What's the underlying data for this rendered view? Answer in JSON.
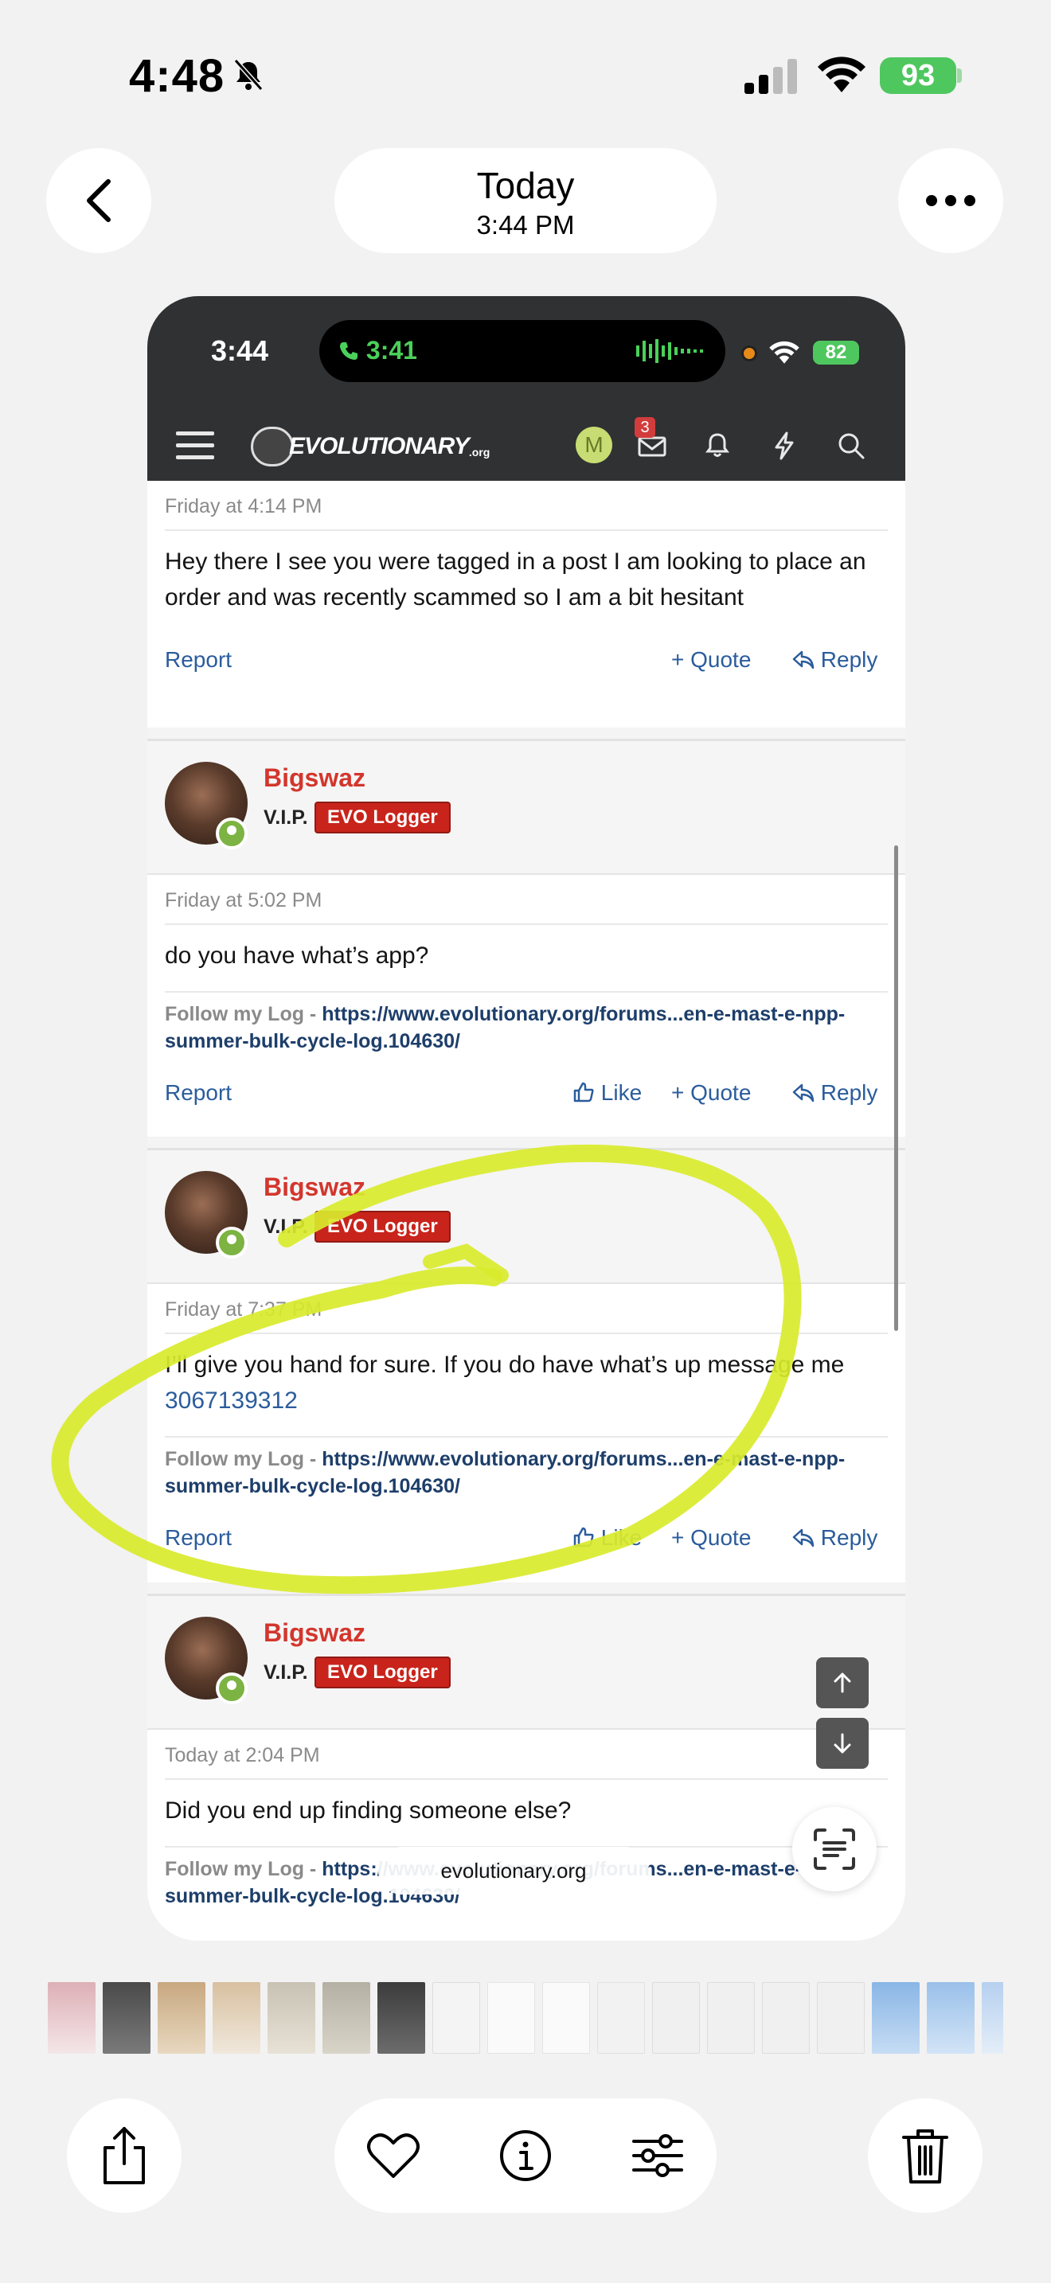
{
  "os_status": {
    "time": "4:48",
    "battery": "93"
  },
  "nav": {
    "title": "Today",
    "subtitle": "3:44 PM"
  },
  "screenshot": {
    "status_time": "3:44",
    "call_time": "3:41",
    "battery": "82",
    "site": {
      "logo": "EVOLUTIONARY",
      "logo_suffix": ".org",
      "avatar_letter": "M",
      "inbox_count": "3"
    },
    "posts": [
      {
        "date": "Friday at 4:14 PM",
        "message": "Hey there I see you were tagged in a post I am looking to place an order and was recently scammed so I am a bit hesitant",
        "actions": {
          "report": "Report",
          "quote": "+ Quote",
          "reply": "Reply"
        }
      },
      {
        "username": "Bigswaz",
        "role": "V.I.P.",
        "badge": "EVO Logger",
        "date": "Friday at 5:02 PM",
        "message": "do you have what’s app?",
        "sig_prefix": "Follow my Log - ",
        "sig_link": "https://www.evolutionary.org/forums...en-e-mast-e-npp-summer-bulk-cycle-log.104630/",
        "actions": {
          "report": "Report",
          "like": "Like",
          "quote": "+ Quote",
          "reply": "Reply"
        }
      },
      {
        "username": "Bigswaz",
        "role": "V.I.P.",
        "badge": "EVO Logger",
        "date": "Friday at 7:37 PM",
        "message": "I’ll give you hand for sure. If you do have what’s up message me ",
        "phone": "3067139312",
        "sig_prefix": "Follow my Log - ",
        "sig_link": "https://www.evolutionary.org/forums...en-e-mast-e-npp-summer-bulk-cycle-log.104630/",
        "actions": {
          "report": "Report",
          "like": "Like",
          "quote": "+ Quote",
          "reply": "Reply"
        }
      },
      {
        "username": "Bigswaz",
        "role": "V.I.P.",
        "badge": "EVO Logger",
        "date": "Today at 2:04 PM",
        "message": "Did you end up finding someone else?",
        "sig_prefix": "Follow my Log - ",
        "sig_link": "https://www.evolutionary.org/forums...en-e-mast-e-npp-summer-bulk-cycle-log.104630/"
      }
    ],
    "url": "evolutionary.org"
  },
  "colors": {
    "highlight": "#d9ea2c",
    "username": "#d3362d",
    "badge": "#c8241b",
    "link": "#2b5c9c"
  }
}
